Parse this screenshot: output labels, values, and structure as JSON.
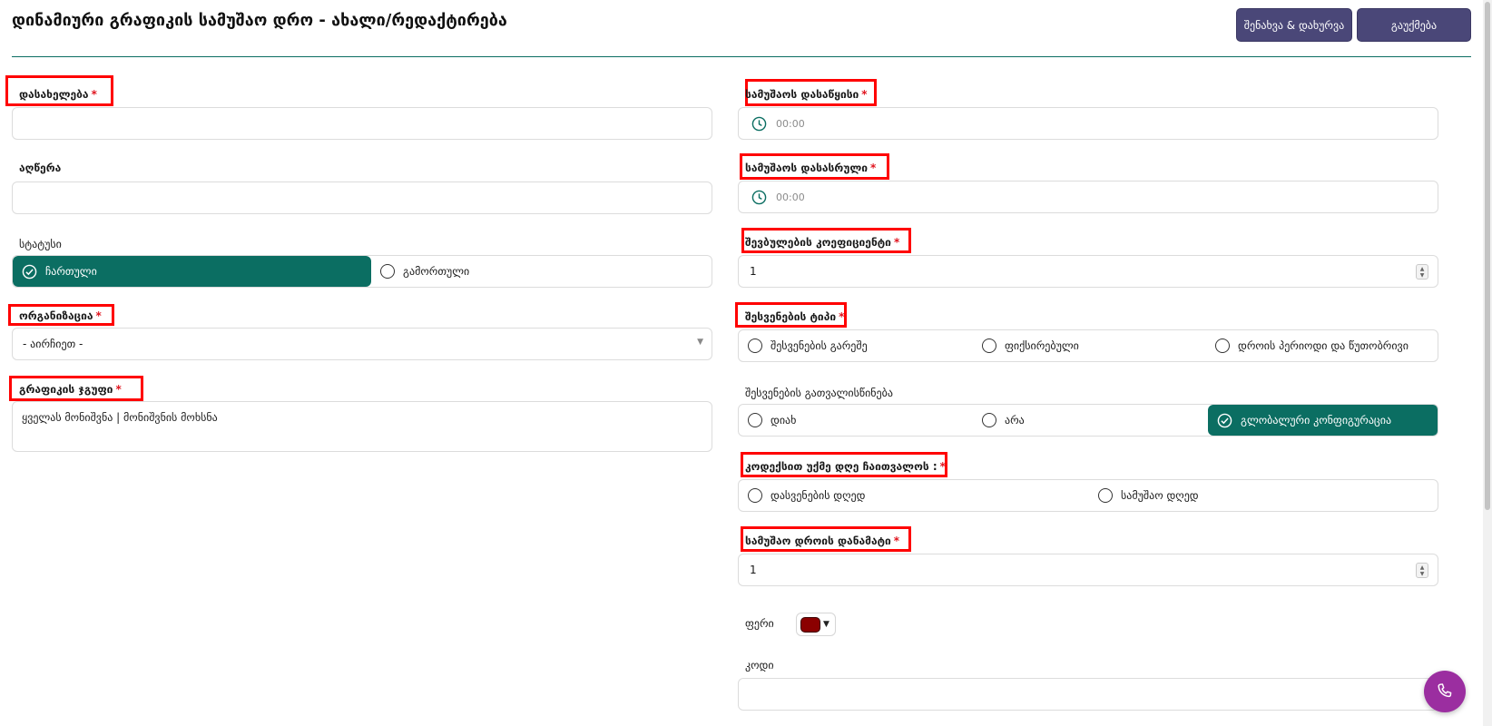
{
  "header": {
    "title": "დინამიური გრაფიკის სამუშაო დრო - ახალი/რედაქტირება",
    "save_label": "შენახვა & დახურვა",
    "cancel_label": "გაუქმება"
  },
  "left": {
    "name": {
      "label": "დასახელება",
      "required": "*",
      "value": ""
    },
    "description": {
      "label": "აღწერა",
      "value": ""
    },
    "status": {
      "label": "სტატუსი",
      "options": [
        "ჩართული",
        "გამორთული"
      ],
      "selected": "ჩართული"
    },
    "organization": {
      "label": "ორგანიზაცია",
      "required": "*",
      "value": "- აირჩიეთ -"
    },
    "schedule_group": {
      "label": "გრაფიკის ჯგუფი",
      "required": "*",
      "select_all": "ყველას მონიშვნა",
      "separator": "|",
      "clear_all": "მონიშვნის მოხსნა"
    }
  },
  "right": {
    "work_start": {
      "label": "სამუშაოს დასაწყისი",
      "required": "*",
      "value": "00:00"
    },
    "work_end": {
      "label": "სამუშაოს დასასრული",
      "required": "*",
      "value": "00:00"
    },
    "reduction_coef": {
      "label": "შევბულების კოეფიციენტი",
      "required": "*",
      "value": "1"
    },
    "break_type": {
      "label": "შესვენების ტიპი",
      "required": "*",
      "options": [
        "შესვენების გარეშე",
        "ფიქსირებული",
        "დროის პერიოდი და წუთობრივი"
      ]
    },
    "break_consider": {
      "label": "შესვენების გათვალისწინება",
      "options": [
        "დიახ",
        "არა",
        "გლობალური კონფიგურაცია"
      ],
      "selected": "გლობალური კონფიგურაცია"
    },
    "holiday_count": {
      "label": "კოდექსით უქმე დღე ჩაითვალოს :",
      "required": "*",
      "options": [
        "დასვენების დღედ",
        "სამუშაო დღედ"
      ]
    },
    "work_time_extra": {
      "label": "სამუშაო დროის დანამატი",
      "required": "*",
      "value": "1"
    },
    "color": {
      "label": "ფერი",
      "value": "#8b0000"
    },
    "code": {
      "label": "კოდი",
      "value": ""
    }
  },
  "colors": {
    "accent": "#0b6e62",
    "button": "#4a4778",
    "required": "#e0151f",
    "highlight": "#ff0000",
    "fab": "#9b2ea0"
  },
  "icons": {
    "time": "clock-icon",
    "check": "check-circle-icon",
    "fab": "phone-icon"
  }
}
